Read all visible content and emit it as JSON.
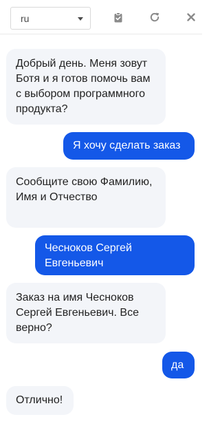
{
  "toolbar": {
    "language": {
      "value": "ru"
    },
    "icons": {
      "clipboard": "clipboard-icon",
      "refresh": "refresh-icon",
      "close": "close-icon"
    }
  },
  "chat": {
    "messages": [
      {
        "sender": "bot",
        "text": "Добрый день. Меня зовут Ботя и я готов помочь вам с выбором программного продукта?"
      },
      {
        "sender": "user",
        "text": "Я хочу сделать заказ"
      },
      {
        "sender": "bot",
        "text": "Сообщите свою Фамилию, Имя и Отчество"
      },
      {
        "sender": "user",
        "text": "Чесноков Сергей Евгеньевич"
      },
      {
        "sender": "bot",
        "text": "Заказ на имя Чесноков Сергей Евгеньевич. Все верно?"
      },
      {
        "sender": "user",
        "text": "да"
      },
      {
        "sender": "bot",
        "text": "Отлично!"
      }
    ]
  },
  "colors": {
    "user_bubble": "#1458e8",
    "bot_bubble": "#f3f5f9",
    "icon": "#8a8a8a"
  }
}
